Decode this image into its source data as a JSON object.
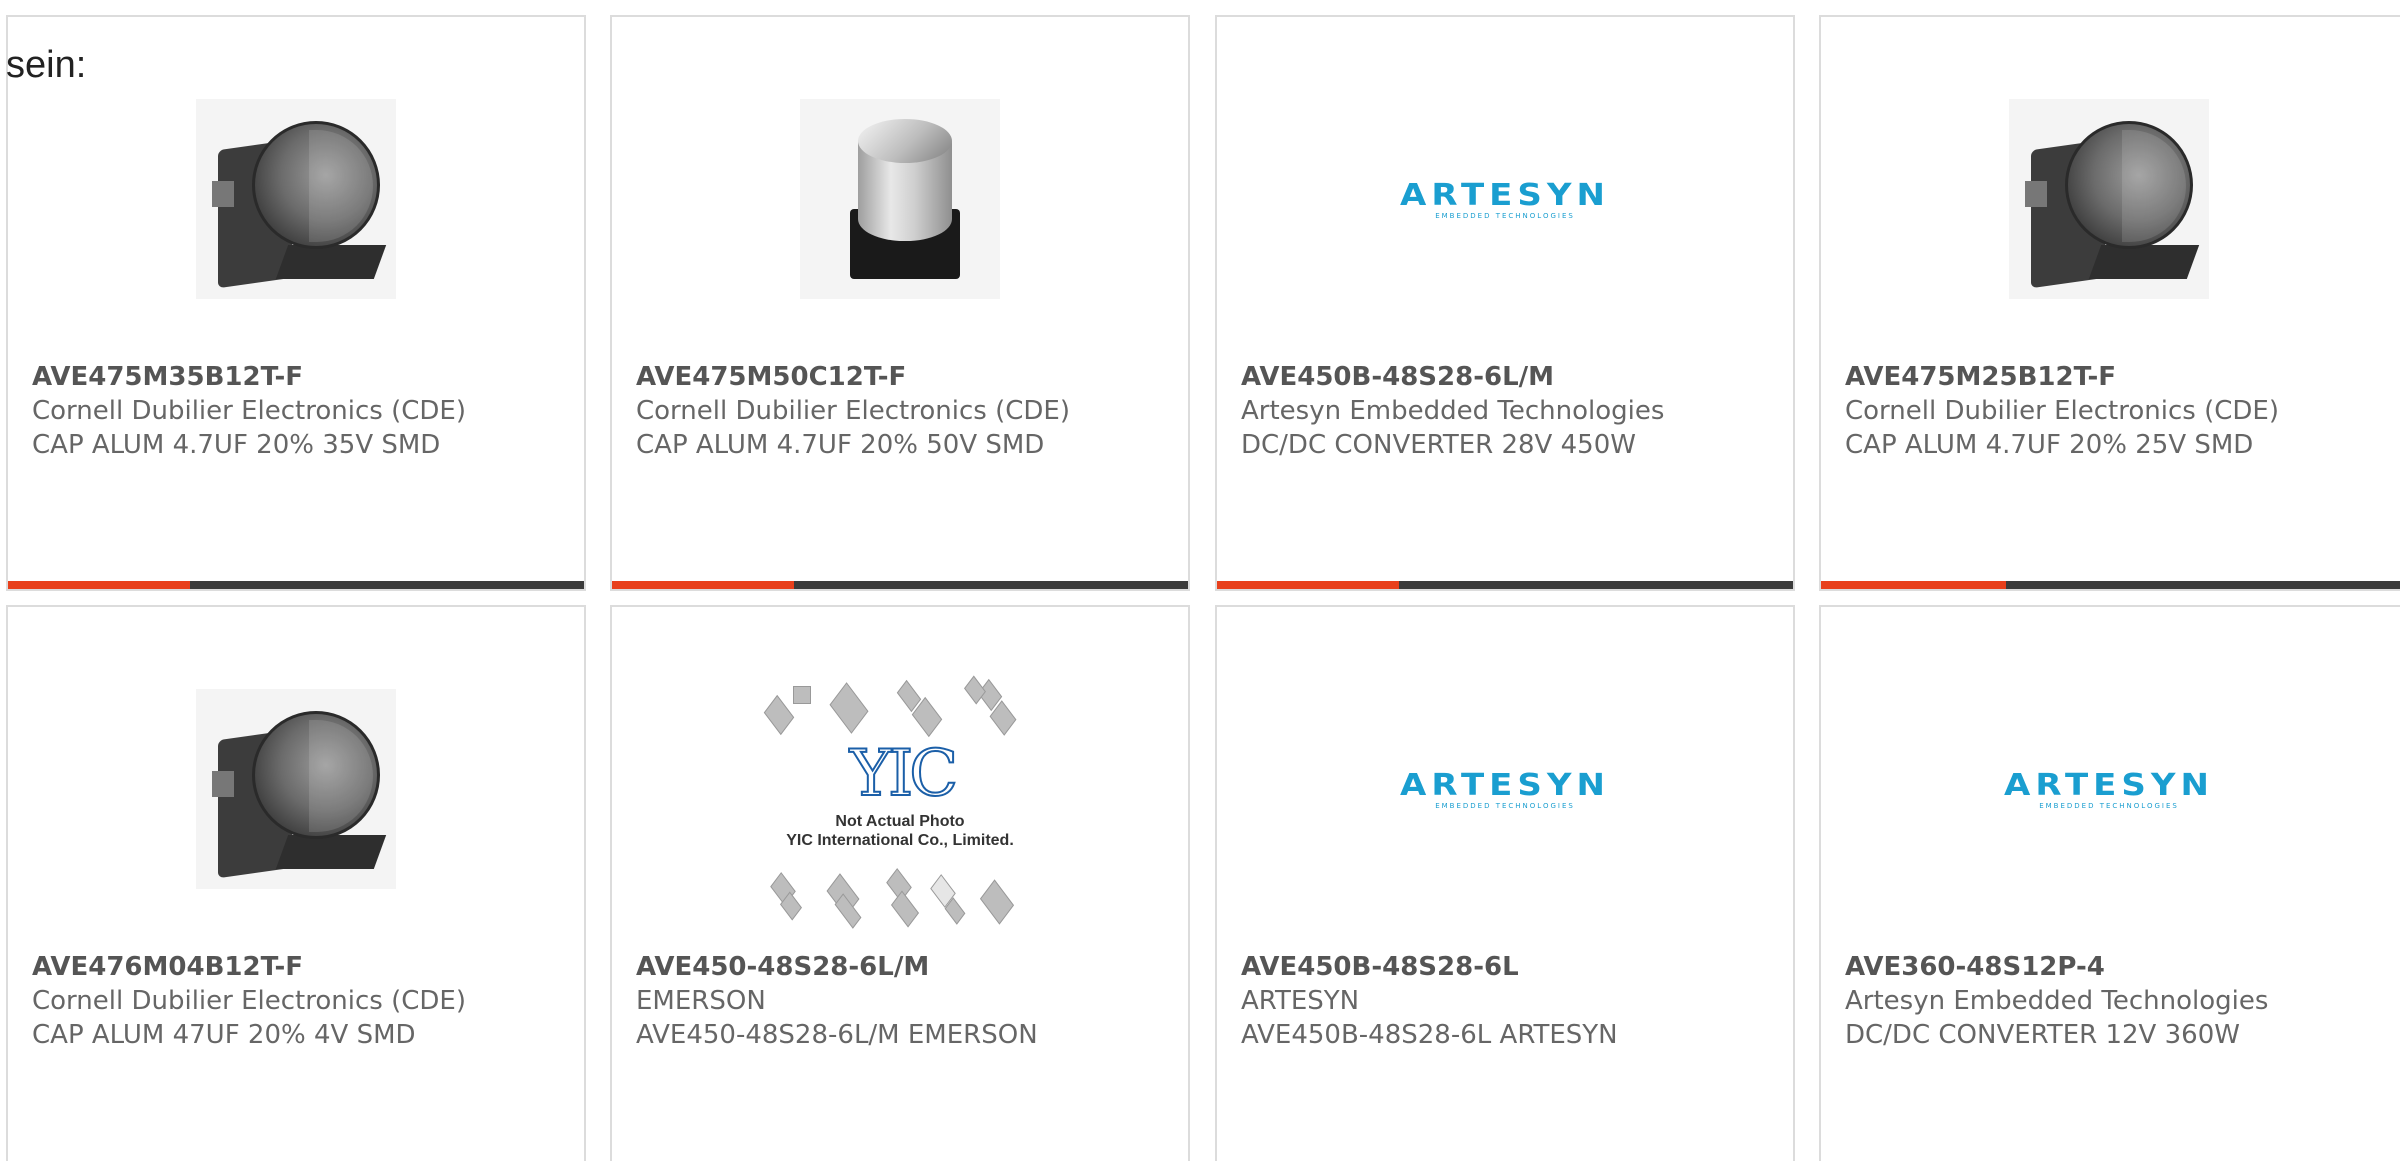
{
  "intro_text": "sein:",
  "colors": {
    "accent": "#e8401c",
    "bar": "#3b3b3b",
    "border": "#dcdcdc",
    "artesyn_blue": "#1a9ed0",
    "yic_blue": "#1b5fa8"
  },
  "products": [
    {
      "part": "AVE475M35B12T-F",
      "manufacturer": "Cornell Dubilier Electronics (CDE)",
      "description": "CAP ALUM 4.7UF 20% 35V SMD",
      "image": "smd-capacitor-dark",
      "accent_fraction": 0.316
    },
    {
      "part": "AVE475M50C12T-F",
      "manufacturer": "Cornell Dubilier Electronics (CDE)",
      "description": "CAP ALUM 4.7UF 20% 50V SMD",
      "image": "smd-capacitor-silver",
      "accent_fraction": 0.316
    },
    {
      "part": "AVE450B-48S28-6L/M",
      "manufacturer": "Artesyn Embedded Technologies",
      "description": "DC/DC CONVERTER 28V 450W",
      "image": "artesyn-logo",
      "accent_fraction": 0.316
    },
    {
      "part": "AVE475M25B12T-F",
      "manufacturer": "Cornell Dubilier Electronics (CDE)",
      "description": "CAP ALUM 4.7UF 20% 25V SMD",
      "image": "smd-capacitor-dark",
      "accent_fraction": 0.316
    },
    {
      "part": "AVE476M04B12T-F",
      "manufacturer": "Cornell Dubilier Electronics (CDE)",
      "description": "CAP ALUM 47UF 20% 4V SMD",
      "image": "smd-capacitor-dark"
    },
    {
      "part": "AVE450-48S28-6L/M",
      "manufacturer": "EMERSON",
      "description": "AVE450-48S28-6L/M EMERSON",
      "image": "yic-placeholder",
      "placeholder_line1": "Not Actual Photo",
      "placeholder_line2": "YIC International Co., Limited.",
      "placeholder_logo": "YIC"
    },
    {
      "part": "AVE450B-48S28-6L",
      "manufacturer": "ARTESYN",
      "description": "AVE450B-48S28-6L ARTESYN",
      "image": "artesyn-logo"
    },
    {
      "part": "AVE360-48S12P-4",
      "manufacturer": "Artesyn Embedded Technologies",
      "description": "DC/DC CONVERTER 12V 360W",
      "image": "artesyn-logo"
    }
  ],
  "artesyn_logo": {
    "word": "ARTESYN",
    "tagline": "EMBEDDED TECHNOLOGIES"
  }
}
